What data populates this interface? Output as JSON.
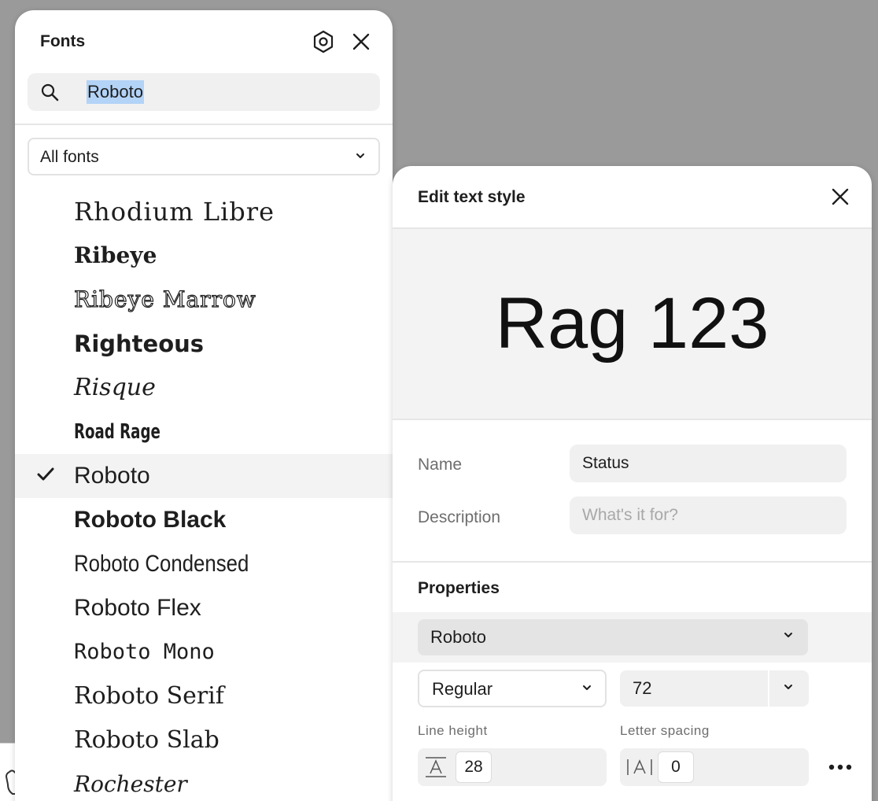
{
  "fonts_panel": {
    "title": "Fonts",
    "search": {
      "value": "Roboto"
    },
    "filter": {
      "selected": "All fonts"
    },
    "font_list": [
      {
        "name": "Rhodium Libre",
        "selected": false
      },
      {
        "name": "Ribeye",
        "selected": false
      },
      {
        "name": "Ribeye Marrow",
        "selected": false
      },
      {
        "name": "Righteous",
        "selected": false
      },
      {
        "name": "Risque",
        "selected": false
      },
      {
        "name": "Road Rage",
        "selected": false
      },
      {
        "name": "Roboto",
        "selected": true
      },
      {
        "name": "Roboto Black",
        "selected": false
      },
      {
        "name": "Roboto Condensed",
        "selected": false
      },
      {
        "name": "Roboto Flex",
        "selected": false
      },
      {
        "name": "Roboto Mono",
        "selected": false
      },
      {
        "name": "Roboto Serif",
        "selected": false
      },
      {
        "name": "Roboto Slab",
        "selected": false
      },
      {
        "name": "Rochester",
        "selected": false
      }
    ]
  },
  "edit_panel": {
    "title": "Edit text style",
    "preview_text": "Rag 123",
    "name_label": "Name",
    "name_value": "Status",
    "description_label": "Description",
    "description_placeholder": "What's it for?",
    "properties_title": "Properties",
    "font_family": "Roboto",
    "font_weight": "Regular",
    "font_size": "72",
    "line_height_label": "Line height",
    "line_height_value": "28",
    "letter_spacing_label": "Letter spacing",
    "letter_spacing_value": "0"
  },
  "colors": {
    "backdrop": "#9a9a9a",
    "panel_bg": "#ffffff",
    "field_bg": "#f0f0f0",
    "selection_highlight": "#b3d3f7",
    "selected_row_bg": "#f3f3f3"
  }
}
